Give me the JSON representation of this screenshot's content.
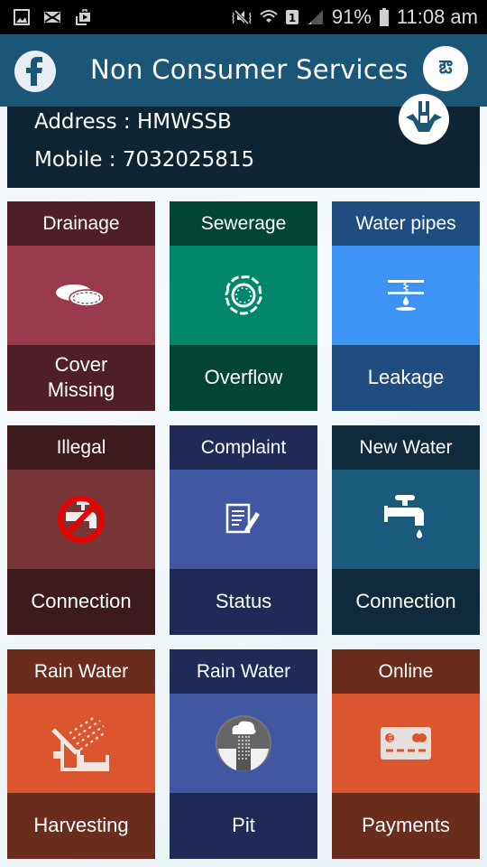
{
  "status_bar": {
    "left_icons": [
      "gallery-icon",
      "mail-icon",
      "play-store-icon"
    ],
    "right_icons": [
      "mute-vibrate-icon",
      "wifi-icon",
      "sim-1-icon",
      "signal-icon"
    ],
    "battery": "91%",
    "time": "11:08 am"
  },
  "app_bar": {
    "title": "Non Consumer Services",
    "left_button": "facebook-icon",
    "right_button_glyph": "ఔ"
  },
  "info": {
    "address": "Address : HMWSSB",
    "mobile": "Mobile : 7032025815"
  },
  "tiles": [
    {
      "head": "Drainage",
      "foot": [
        "Cover",
        "Missing"
      ],
      "icon": "manhole-cover-icon",
      "colors": {
        "dark": "#4e1e29",
        "mid": "#9a3a4e"
      }
    },
    {
      "head": "Sewerage",
      "foot": [
        "Overflow"
      ],
      "icon": "sewer-overflow-icon",
      "colors": {
        "dark": "#034535",
        "mid": "#00876a"
      }
    },
    {
      "head": "Water pipes",
      "foot": [
        "Leakage"
      ],
      "icon": "pipe-leak-icon",
      "colors": {
        "dark": "#204d80",
        "mid": "#3d94f5"
      }
    },
    {
      "head": "Illegal",
      "foot": [
        "Connection"
      ],
      "icon": "no-tap-icon",
      "colors": {
        "dark": "#3d1b1c",
        "mid": "#783535"
      }
    },
    {
      "head": "Complaint",
      "foot": [
        "Status"
      ],
      "icon": "edit-document-icon",
      "colors": {
        "dark": "#1f2a56",
        "mid": "#4257a4"
      }
    },
    {
      "head": "New Water",
      "foot": [
        "Connection"
      ],
      "icon": "water-tap-icon",
      "colors": {
        "dark": "#0e2a3c",
        "mid": "#195a7d"
      }
    },
    {
      "head": "Rain Water",
      "foot": [
        "Harvesting"
      ],
      "icon": "rain-harvest-icon",
      "colors": {
        "dark": "#6a2c1c",
        "mid": "#db552f"
      }
    },
    {
      "head": "Rain Water",
      "foot": [
        "Pit"
      ],
      "icon": "rain-pit-icon",
      "colors": {
        "dark": "#1f2a56",
        "mid": "#4257a4"
      }
    },
    {
      "head": "Online",
      "foot": [
        "Payments"
      ],
      "icon": "credit-card-icon",
      "colors": {
        "dark": "#6a2c1c",
        "mid": "#db552f"
      }
    }
  ]
}
